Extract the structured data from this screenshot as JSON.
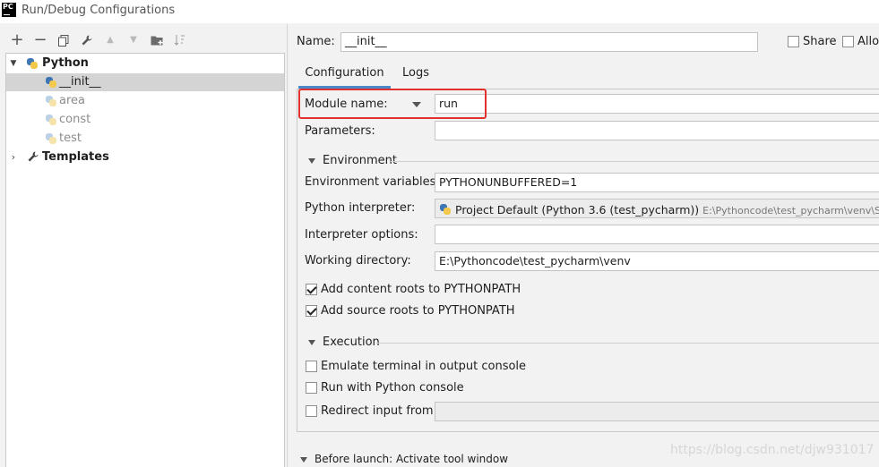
{
  "window": {
    "title": "Run/Debug Configurations",
    "logo_text": "PC"
  },
  "toolbar": {
    "icons": [
      "plus-icon",
      "minus-icon",
      "copy-icon",
      "wrench-icon",
      "arrow-up-icon",
      "arrow-down-icon",
      "folder-icon",
      "sort-icon"
    ]
  },
  "tree": {
    "python_group": "Python",
    "items": [
      "__init__",
      "area",
      "const",
      "test"
    ],
    "templates": "Templates"
  },
  "header": {
    "name_label": "Name:",
    "name_value": "__init__",
    "share_label": "Share",
    "allow_label": "Allow"
  },
  "tabs": {
    "configuration": "Configuration",
    "logs": "Logs"
  },
  "config": {
    "module_name_label": "Module name:",
    "module_name_value": "run",
    "parameters_label": "Parameters:",
    "parameters_value": "",
    "environment_section": "Environment",
    "env_vars_label": "Environment variables:",
    "env_vars_value": "PYTHONUNBUFFERED=1",
    "interpreter_label": "Python interpreter:",
    "interpreter_value": "Project Default (Python 3.6 (test_pycharm))",
    "interpreter_path": "E:\\Pythoncode\\test_pycharm\\venv\\Scripts\\",
    "interp_options_label": "Interpreter options:",
    "interp_options_value": "",
    "working_dir_label": "Working directory:",
    "working_dir_value": "E:\\Pythoncode\\test_pycharm\\venv",
    "add_content_roots": "Add content roots to PYTHONPATH",
    "add_source_roots": "Add source roots to PYTHONPATH",
    "execution_section": "Execution",
    "emulate_terminal": "Emulate terminal in output console",
    "run_with_console": "Run with Python console",
    "redirect_input": "Redirect input from:"
  },
  "before_launch": "Before launch: Activate tool window",
  "watermark": "https://blog.csdn.net/djw931017",
  "colors": {
    "accent": "#4a88c7",
    "highlight": "#e03030",
    "selected_row": "#d4d4d4"
  }
}
